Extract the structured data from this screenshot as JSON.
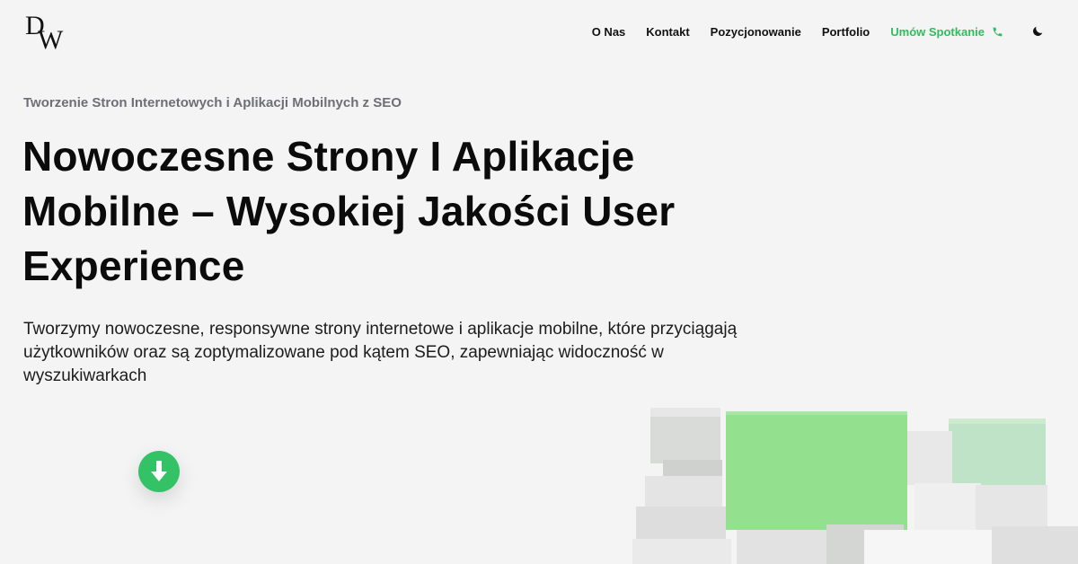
{
  "logo": {
    "d": "D",
    "w": "W"
  },
  "nav": {
    "items": [
      "O Nas",
      "Kontakt",
      "Pozycjonowanie",
      "Portfolio"
    ],
    "cta_label": "Umów Spotkanie",
    "cta_icon": "phone-icon",
    "theme_icon": "moon-icon"
  },
  "hero": {
    "eyebrow": "Tworzenie Stron Internetowych i Aplikacji Mobilnych z SEO",
    "headline": "Nowoczesne Strony I Aplikacje Mobilne – Wysokiej Jakości User Experience",
    "lead": "Tworzymy nowoczesne, responsywne strony internetowe i aplikacje mobilne, które przyciągają użytkowników oraz są zoptymalizowane pod kątem SEO, zapewniając widoczność w wyszukiwarkach",
    "scroll_icon": "arrow-down-icon"
  },
  "colors": {
    "background": "#f4f4f4",
    "accent": "#33c265",
    "cta_text": "#2fbe5b",
    "block_green": "#93e18e"
  }
}
